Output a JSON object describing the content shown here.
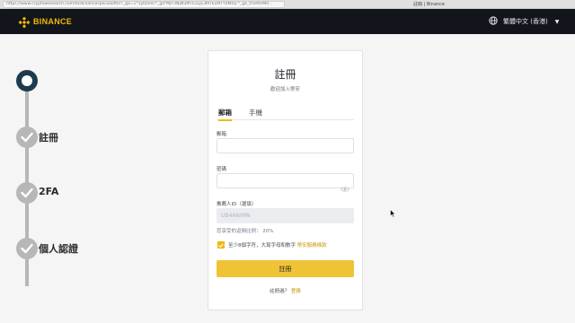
{
  "browser": {
    "url": "https://www.cryptowesearch.com/hk/binancespecialoffer?_ga=1*1ytzomc*_ga*MjY3NjM3MTE5LjE3MTk1MTY0MzQ.*_ga_V59XHM0...",
    "title": "註冊 | Binance"
  },
  "header": {
    "brand": "BINANCE",
    "brand_color": "#f0b90b",
    "language": "繁體中文 (香港)",
    "globe_icon": "globe-icon",
    "caret_icon": "caret-down-icon"
  },
  "stepper": {
    "steps": [
      {
        "label": "",
        "state": "current"
      },
      {
        "label": "註冊",
        "state": "done"
      },
      {
        "label": "2FA",
        "state": "done"
      },
      {
        "label": "個人認證",
        "state": "done"
      }
    ]
  },
  "form": {
    "title": "註冊",
    "subtitle": "歡迎加入幣安",
    "tabs": [
      {
        "label": "郵箱",
        "active": true
      },
      {
        "label": "手機",
        "active": false
      }
    ],
    "email_label": "郵箱",
    "email_value": "",
    "password_label": "密碼",
    "password_value": "",
    "referral_label": "推薦人ID（選填）",
    "referral_value": "UB4ANIMN",
    "commission_rate": "您享受的返佣比例： 20%",
    "terms_text": "至少8個字符，大寫字母和數字",
    "terms_link": "幣安服務條款",
    "terms_checked": true,
    "submit_label": "註冊",
    "already_text": "註冊過？",
    "login_link": "登錄",
    "accent_color": "#f0b90b"
  }
}
